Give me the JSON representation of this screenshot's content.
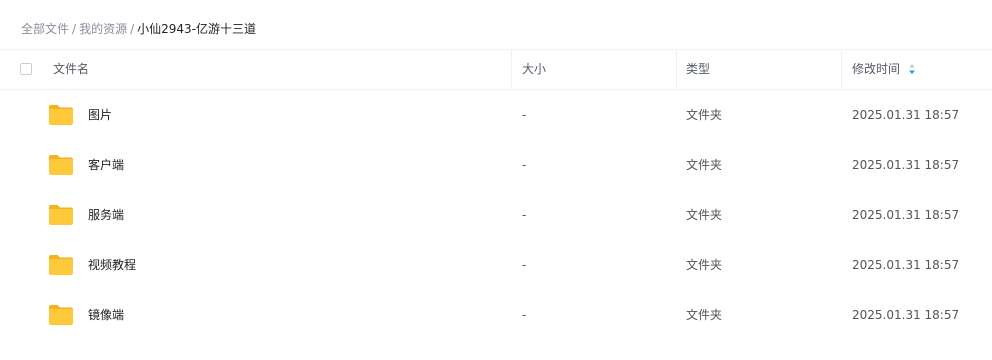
{
  "breadcrumb": {
    "items": [
      "全部文件",
      "我的资源"
    ],
    "separator": "/",
    "current": "小仙2943-亿游十三道"
  },
  "table": {
    "headers": {
      "name": "文件名",
      "size": "大小",
      "type": "类型",
      "modified": "修改时间"
    },
    "sort_icon": "sort-desc-icon",
    "rows": [
      {
        "name": "图片",
        "size": "-",
        "type": "文件夹",
        "modified": "2025.01.31 18:57",
        "icon": "folder-icon"
      },
      {
        "name": "客户端",
        "size": "-",
        "type": "文件夹",
        "modified": "2025.01.31 18:57",
        "icon": "folder-icon"
      },
      {
        "name": "服务端",
        "size": "-",
        "type": "文件夹",
        "modified": "2025.01.31 18:57",
        "icon": "folder-icon"
      },
      {
        "name": "视频教程",
        "size": "-",
        "type": "文件夹",
        "modified": "2025.01.31 18:57",
        "icon": "folder-icon"
      },
      {
        "name": "镜像端",
        "size": "-",
        "type": "文件夹",
        "modified": "2025.01.31 18:57",
        "icon": "folder-icon"
      }
    ]
  },
  "colors": {
    "folder": "#FFC93C",
    "sort_active": "#06A7FF",
    "border": "#EEF0F3"
  }
}
